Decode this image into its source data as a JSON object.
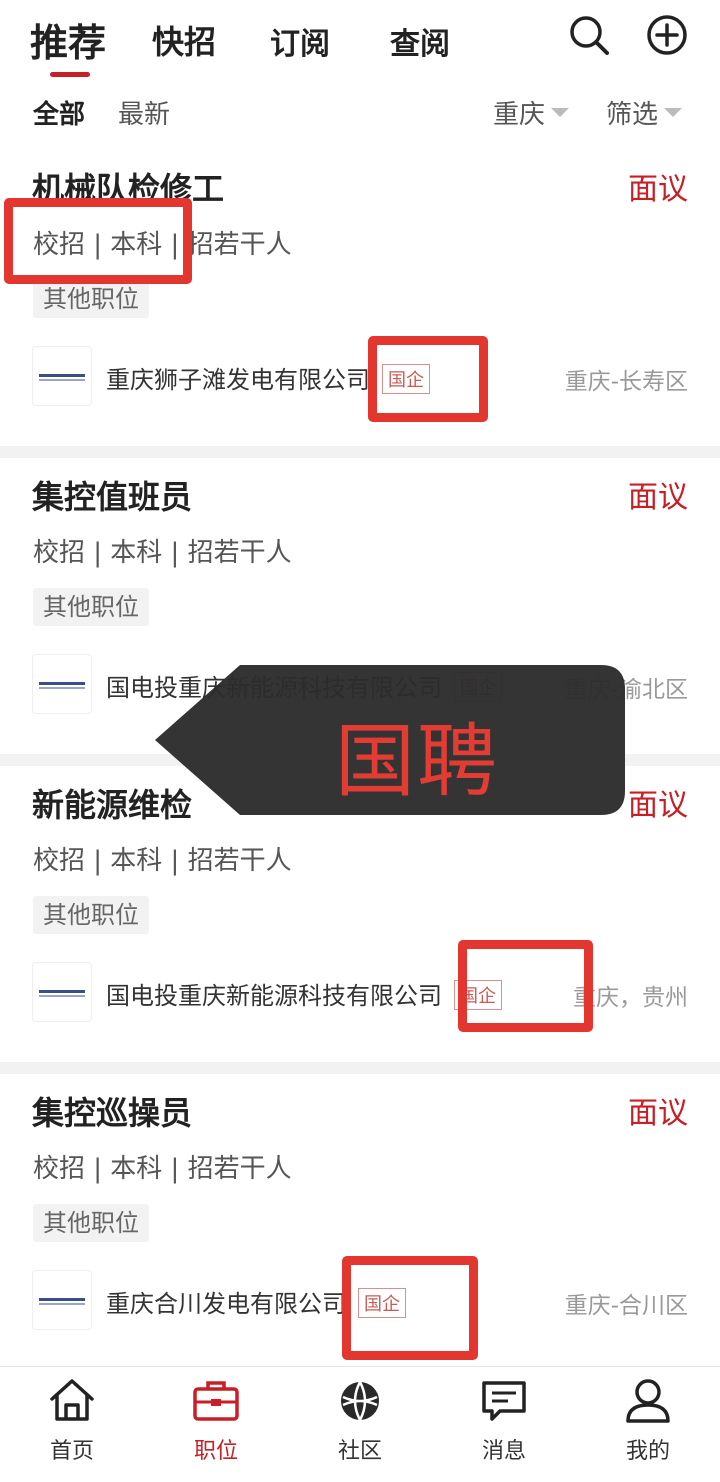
{
  "header": {
    "tabs": [
      {
        "label": "推荐",
        "active": true
      },
      {
        "label": "快招"
      },
      {
        "label": "订阅"
      },
      {
        "label": "查阅"
      }
    ],
    "search_icon": "search-icon",
    "add_icon": "plus-circle-icon"
  },
  "filters": {
    "all_label": "全部",
    "latest_label": "最新",
    "city_label": "重庆",
    "filter_label": "筛选"
  },
  "jobs": [
    {
      "title": "机械队检修工",
      "salary": "面议",
      "meta": "校招 | 本科 | 招若干人",
      "tag": "其他职位",
      "company": "重庆狮子滩发电有限公司",
      "badge": "国企",
      "location": "重庆-长寿区"
    },
    {
      "title": "集控值班员",
      "salary": "面议",
      "meta": "校招 | 本科 | 招若干人",
      "tag": "其他职位",
      "company": "国电投重庆新能源科技有限公司",
      "badge": "国企",
      "location": "重庆-渝北区"
    },
    {
      "title": "新能源维检",
      "salary": "面议",
      "meta": "校招 | 本科 | 招若干人",
      "tag": "其他职位",
      "company": "国电投重庆新能源科技有限公司",
      "badge": "国企",
      "location": "重庆，贵州"
    },
    {
      "title": "集控巡操员",
      "salary": "面议",
      "meta": "校招 | 本科 | 招若干人",
      "tag": "其他职位",
      "company": "重庆合川发电有限公司",
      "badge": "国企",
      "location": "重庆-合川区"
    }
  ],
  "overlay": {
    "text": "国聘"
  },
  "colors": {
    "accent": "#c81e25",
    "annotation": "#e2362e"
  },
  "bottom_nav": [
    {
      "label": "首页",
      "icon": "home-icon"
    },
    {
      "label": "职位",
      "icon": "briefcase-icon",
      "active": true
    },
    {
      "label": "社区",
      "icon": "globe-icon"
    },
    {
      "label": "消息",
      "icon": "message-icon"
    },
    {
      "label": "我的",
      "icon": "user-icon"
    }
  ]
}
